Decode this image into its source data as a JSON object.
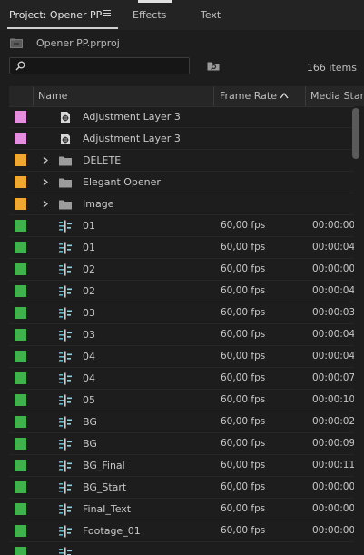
{
  "tabs": [
    {
      "label": "Project: Opener PP"
    },
    {
      "label": "Effects"
    },
    {
      "label": "Text"
    }
  ],
  "project": {
    "file": "Opener PP.prproj"
  },
  "search": {
    "value": "",
    "placeholder": ""
  },
  "item_count": "166 items",
  "columns": {
    "name": "Name",
    "frame_rate": "Frame Rate",
    "media_start": "Media Start"
  },
  "colors": {
    "pink": "#e58ee0",
    "orange": "#f0a830",
    "green": "#3fb24c"
  },
  "rows": [
    {
      "color": "pink",
      "icon": "adjustment-layer-icon",
      "name": "Adjustment Layer 3",
      "fps": "",
      "start": ""
    },
    {
      "color": "pink",
      "icon": "adjustment-layer-icon",
      "name": "Adjustment Layer 3",
      "fps": "",
      "start": ""
    },
    {
      "color": "orange",
      "icon": "folder-icon",
      "name": "DELETE",
      "fps": "",
      "start": "",
      "folder": true
    },
    {
      "color": "orange",
      "icon": "folder-icon",
      "name": "Elegant Opener",
      "fps": "",
      "start": "",
      "folder": true
    },
    {
      "color": "orange",
      "icon": "folder-icon",
      "name": "Image",
      "fps": "",
      "start": "",
      "folder": true
    },
    {
      "color": "green",
      "icon": "sequence-icon",
      "name": "01",
      "fps": "60,00 fps",
      "start": "00:00:00"
    },
    {
      "color": "green",
      "icon": "sequence-icon",
      "name": "01",
      "fps": "60,00 fps",
      "start": "00:00:04"
    },
    {
      "color": "green",
      "icon": "sequence-icon",
      "name": "02",
      "fps": "60,00 fps",
      "start": "00:00:00"
    },
    {
      "color": "green",
      "icon": "sequence-icon",
      "name": "02",
      "fps": "60,00 fps",
      "start": "00:00:04"
    },
    {
      "color": "green",
      "icon": "sequence-icon",
      "name": "03",
      "fps": "60,00 fps",
      "start": "00:00:03"
    },
    {
      "color": "green",
      "icon": "sequence-icon",
      "name": "03",
      "fps": "60,00 fps",
      "start": "00:00:04"
    },
    {
      "color": "green",
      "icon": "sequence-icon",
      "name": "04",
      "fps": "60,00 fps",
      "start": "00:00:04"
    },
    {
      "color": "green",
      "icon": "sequence-icon",
      "name": "04",
      "fps": "60,00 fps",
      "start": "00:00:07"
    },
    {
      "color": "green",
      "icon": "sequence-icon",
      "name": "05",
      "fps": "60,00 fps",
      "start": "00:00:10"
    },
    {
      "color": "green",
      "icon": "sequence-icon",
      "name": "BG",
      "fps": "60,00 fps",
      "start": "00:00:02"
    },
    {
      "color": "green",
      "icon": "sequence-icon",
      "name": "BG",
      "fps": "60,00 fps",
      "start": "00:00:09"
    },
    {
      "color": "green",
      "icon": "sequence-icon",
      "name": "BG_Final",
      "fps": "60,00 fps",
      "start": "00:00:11"
    },
    {
      "color": "green",
      "icon": "sequence-icon",
      "name": "BG_Start",
      "fps": "60,00 fps",
      "start": "00:00:00"
    },
    {
      "color": "green",
      "icon": "sequence-icon",
      "name": "Final_Text",
      "fps": "60,00 fps",
      "start": "00:00:00"
    },
    {
      "color": "green",
      "icon": "sequence-icon",
      "name": "Footage_01",
      "fps": "60,00 fps",
      "start": "00:00:00"
    },
    {
      "color": "green",
      "icon": "sequence-icon",
      "name": "",
      "fps": "",
      "start": ""
    }
  ]
}
